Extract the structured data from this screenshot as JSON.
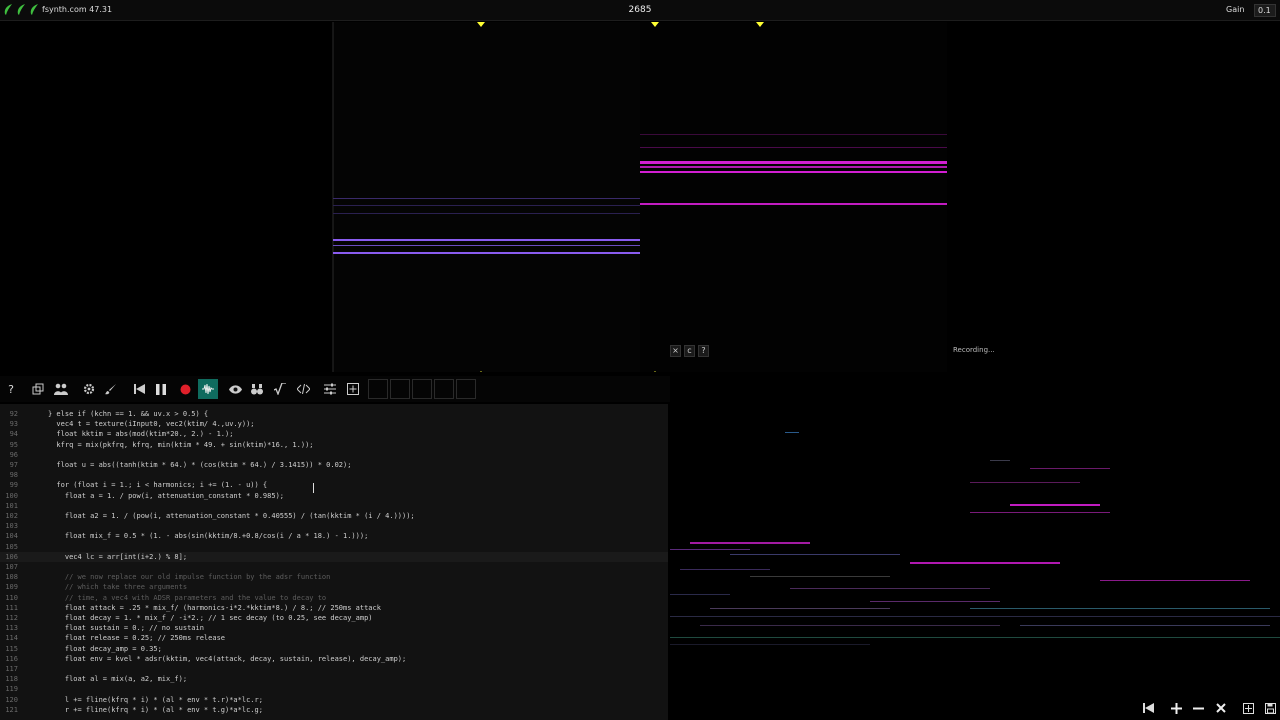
{
  "topbar": {
    "site_title": "fsynth.com 47.31",
    "center_count": "2685",
    "gain_label": "Gain",
    "gain_value": "0.1",
    "leaf_color": "#3fbf3f"
  },
  "recording": {
    "close_glyph": "×",
    "copy_glyph": "c",
    "help_glyph": "?",
    "status": "Recording..."
  },
  "toolbar": {
    "help_glyph": "?",
    "buttons": [
      "help-icon",
      "detach-icon",
      "users-icon",
      "settings-icon",
      "brush-icon",
      "rewind-icon",
      "pause-icon",
      "record-icon",
      "waveform-icon",
      "eye-icon",
      "binoculars-icon",
      "sqrt-icon",
      "code-icon",
      "sliders-icon",
      "plus-box-icon"
    ],
    "active_color": "#0f6b5e",
    "record_color": "#e0202a"
  },
  "code": {
    "lines": [
      {
        "n": "92",
        "t": "} else if (kchn == 1. && uv.x > 0.5) {"
      },
      {
        "n": "93",
        "t": "  vec4 t = texture(iInput0, vec2(ktim/ 4.,uv.y));"
      },
      {
        "n": "94",
        "t": "  float kktim = abs(mod(ktim*20., 2.) - 1.);"
      },
      {
        "n": "95",
        "t": "  kfrq = mix(pkfrq, kfrq, min(ktim * 49. + sin(ktim)*16., 1.));"
      },
      {
        "n": "96",
        "t": ""
      },
      {
        "n": "97",
        "t": "  float u = abs((tanh(ktim * 64.) * (cos(ktim * 64.) / 3.1415)) * 0.02);"
      },
      {
        "n": "98",
        "t": ""
      },
      {
        "n": "99",
        "t": "  for (float i = 1.; i < harmonics; i += (1. - u)) {"
      },
      {
        "n": "100",
        "t": "    float a = 1. / pow(i, attenuation_constant * 0.985);"
      },
      {
        "n": "101",
        "t": ""
      },
      {
        "n": "102",
        "t": "    float a2 = 1. / (pow(i, attenuation_constant * 0.40555) / (tan(kktim * (i / 4.))));"
      },
      {
        "n": "103",
        "t": ""
      },
      {
        "n": "104",
        "t": "    float mix_f = 0.5 * (1. - abs(sin(kktim/8.+0.8/cos(i / a * 18.) - 1.)));"
      },
      {
        "n": "105",
        "t": ""
      },
      {
        "n": "106",
        "t": "    vec4 lc = arr[int(i+2.) % 8];"
      },
      {
        "n": "107",
        "t": ""
      },
      {
        "n": "108",
        "t": "    // we now replace our old impulse function by the adsr function",
        "c": true
      },
      {
        "n": "109",
        "t": "    // which take three arguments",
        "c": true
      },
      {
        "n": "110",
        "t": "    // time, a vec4 with ADSR parameters and the value to decay to",
        "c": true
      },
      {
        "n": "111",
        "t": "    float attack = .25 * mix_f/ (harmonics-i*2.*kktim*8.) / 8.; // 250ms attack"
      },
      {
        "n": "112",
        "t": "    float decay = 1. * mix_f / -i*2.; // 1 sec decay (to 0.25, see decay_amp)"
      },
      {
        "n": "113",
        "t": "    float sustain = 0.; // no sustain"
      },
      {
        "n": "114",
        "t": "    float release = 0.25; // 250ms release"
      },
      {
        "n": "115",
        "t": "    float decay_amp = 0.35;"
      },
      {
        "n": "116",
        "t": "    float env = kvel * adsr(kktim, vec4(attack, decay, sustain, release), decay_amp);"
      },
      {
        "n": "117",
        "t": ""
      },
      {
        "n": "118",
        "t": "    float al = mix(a, a2, mix_f);"
      },
      {
        "n": "119",
        "t": ""
      },
      {
        "n": "120",
        "t": "    l += fline(kfrq * i) * (al * env * t.r)*a*lc.r;"
      },
      {
        "n": "121",
        "t": "    r += fline(kfrq * i) * (al * env * t.g)*a*lc.g;"
      }
    ]
  },
  "bottom_toolbar": {
    "buttons": [
      "skip-back-icon",
      "plus-icon",
      "minus-icon",
      "close-icon",
      "expand-icon",
      "save-icon"
    ]
  },
  "colors": {
    "magenta": "#d21ed2",
    "violet": "#8a5cf0",
    "marker_yellow": "#ffff33"
  }
}
